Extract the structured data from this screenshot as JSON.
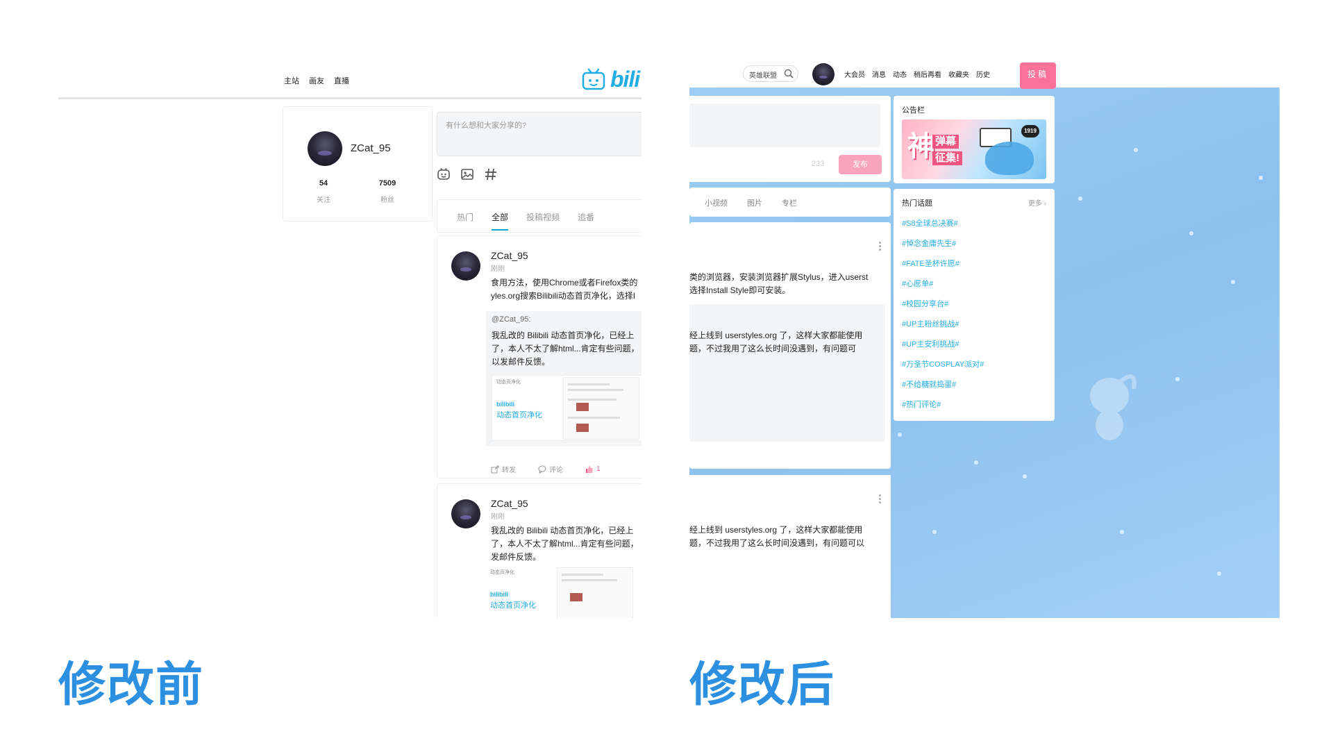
{
  "before": {
    "nav_links": [
      "主站",
      "画友",
      "直播"
    ],
    "logo_text": "bili",
    "profile": {
      "name": "ZCat_95",
      "following": "54",
      "following_label": "关注",
      "followers": "7509",
      "followers_label": "粉丝"
    },
    "compose_placeholder": "有什么想和大家分享的?",
    "tabs": [
      "热门",
      "全部",
      "投稿视频",
      "追番"
    ],
    "active_tab": "全部",
    "post1": {
      "name": "ZCat_95",
      "time": "刚刚",
      "text_lines": [
        "食用方法，使用Chrome或者Firefox类的",
        "yles.org搜索Bilibili动态首页净化，选择I"
      ],
      "quote_at": "@ZCat_95:",
      "quote_lines": [
        "我乱改的 Bilibili 动态首页净化，已经上",
        "了，本人不太了解html...肯定有些问题，",
        "以发邮件反馈。"
      ],
      "thumb_title": "动态页净化",
      "thumb_logo": "bilibili",
      "thumb_sub": "动态首页净化",
      "actions": {
        "share": "转发",
        "comment": "评论",
        "like": "1"
      }
    },
    "post2": {
      "name": "ZCat_95",
      "time": "刚刚",
      "text_lines": [
        "我乱改的 Bilibili 动态首页净化，已经上",
        "了，本人不太了解html...肯定有些问题，",
        "发邮件反馈。"
      ],
      "thumb_title": "动态页净化",
      "thumb_logo": "bilibili",
      "thumb_sub": "动态首页净化"
    }
  },
  "after": {
    "search_value": "英雄联盟",
    "nav_links": [
      "大会员",
      "消息",
      "动态",
      "稍后再看",
      "收藏夹",
      "历史"
    ],
    "upload_label": "投稿",
    "compose": {
      "count": "233",
      "publish": "发布"
    },
    "tabs": [
      "小视频",
      "图片",
      "专栏"
    ],
    "post1_lines": [
      "类的浏览器，安装浏览器扩展Stylus，进入userst",
      "选择Install Style即可安装。"
    ],
    "quote_lines": [
      "经上线到 userstyles.org 了，这样大家都能使用",
      "题，不过我用了这么长时间没遇到，有问题可"
    ],
    "post2_lines": [
      "经上线到 userstyles.org 了，这样大家都能使用",
      "题，不过我用了这么长时间没遇到，有问题可以"
    ],
    "notice_title": "公告栏",
    "banner": {
      "big": "神",
      "line1": "弹幕",
      "line2": "征集!",
      "badge": "1919"
    },
    "topics_title": "热门话题",
    "topics_more": "更多",
    "topics": [
      "#S8全球总决赛#",
      "#悼念金庸先生#",
      "#FATE圣杯许愿#",
      "#心愿单#",
      "#校园分享台#",
      "#UP主粉丝挑战#",
      "#UP主安利挑战#",
      "#万圣节COSPLAY派对#",
      "#不给糖就捣蛋#",
      "#热门评论#"
    ]
  },
  "labels": {
    "before": "修改前",
    "after": "修改后"
  },
  "colors": {
    "accent": "#2c8fe0",
    "bili_blue": "#23ade5",
    "pink": "#fb7299",
    "sky": "#9ecdf3"
  }
}
